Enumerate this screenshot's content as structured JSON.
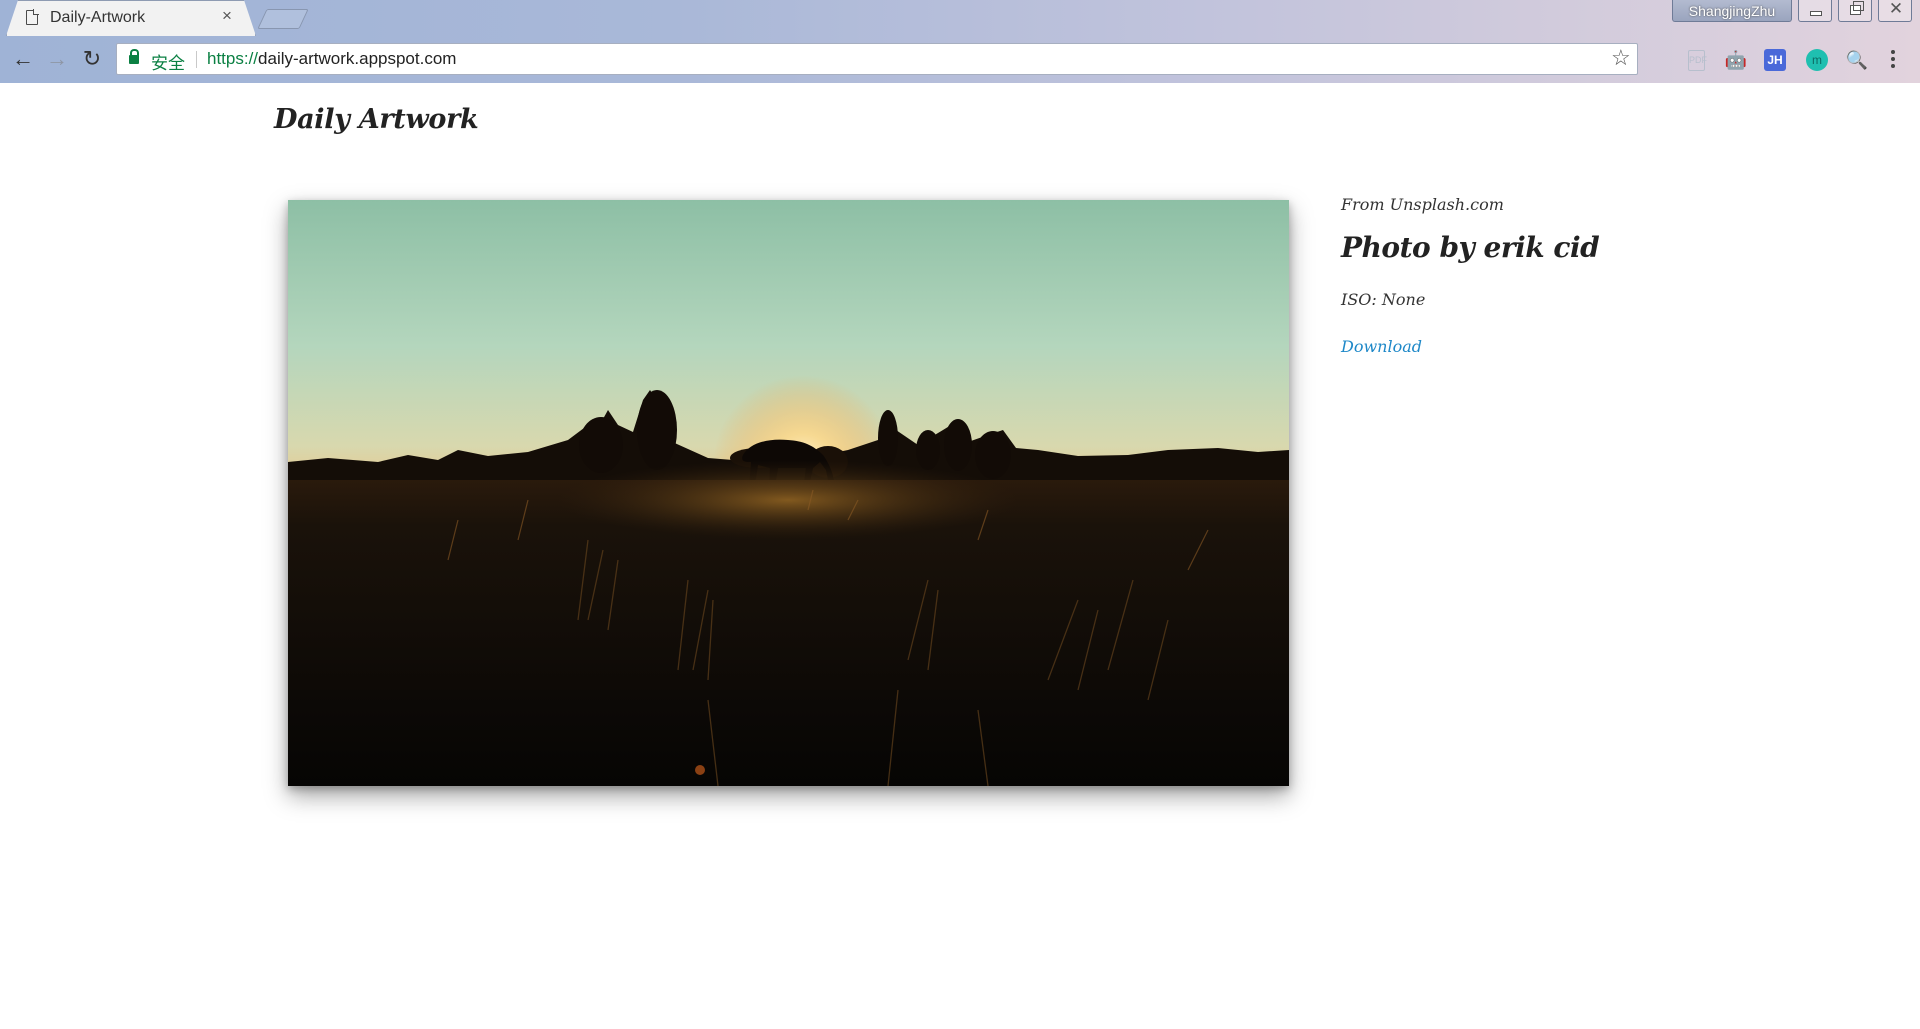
{
  "browser": {
    "tab": {
      "title": "Daily-Artwork",
      "close": "×"
    },
    "profile_name": "ShangjingZhu",
    "window_buttons": {
      "close": "✕"
    },
    "omnibox": {
      "secure_label": "安全",
      "url_scheme": "https://",
      "url_rest": "daily-artwork.appspot.com"
    },
    "nav": {
      "back": "←",
      "forward": "→",
      "reload": "↻"
    },
    "star": "☆",
    "extensions": {
      "pdf": "PDF",
      "android": "🤖",
      "jh": "JH",
      "m": "m",
      "search": "🔍"
    }
  },
  "page": {
    "site_title": "Daily Artwork",
    "source": "From Unsplash.com",
    "photo_title": "Photo by erik cid",
    "iso": "ISO: None",
    "download_label": "Download"
  },
  "colors": {
    "link": "#1e88c8",
    "secure_green": "#0b8043",
    "sky_top": "#8cbfa4",
    "sky_horizon": "#f5a64a"
  }
}
